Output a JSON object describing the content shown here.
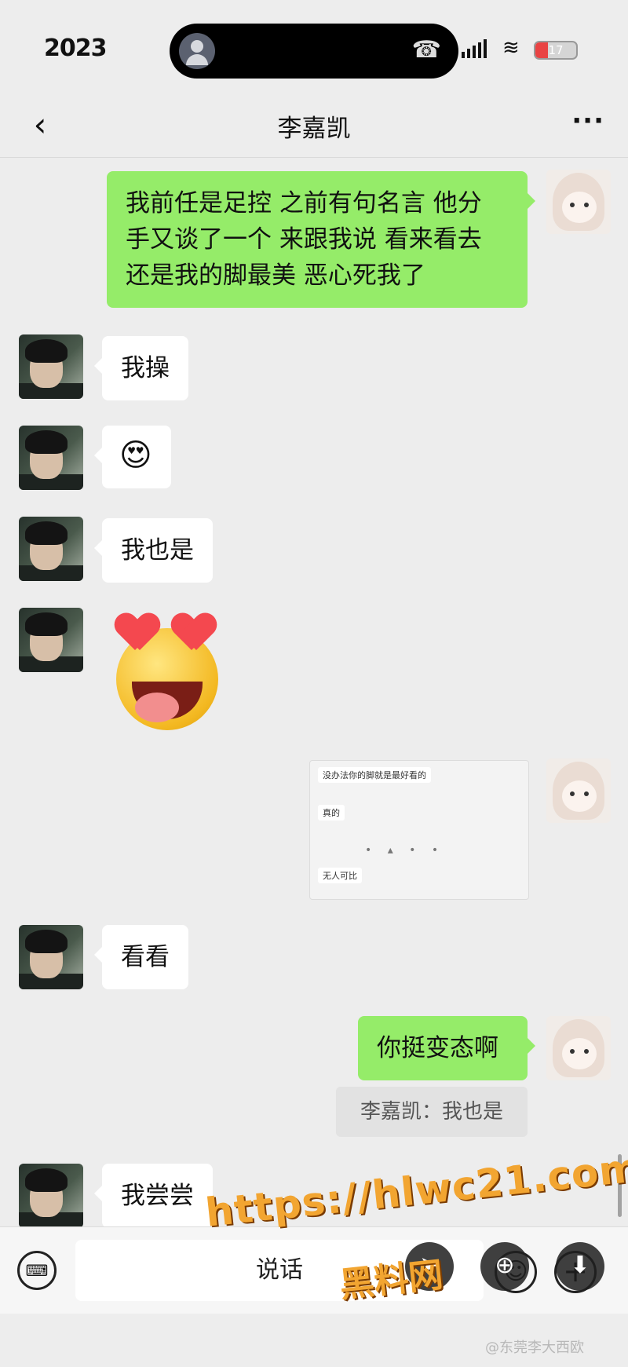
{
  "status_bar": {
    "time": "2023",
    "battery": "17",
    "call_icon": "phone-hangup-icon"
  },
  "nav": {
    "title": "李嘉凯",
    "back_icon": "back-icon",
    "more_label": "···"
  },
  "messages": [
    {
      "side": "out",
      "type": "text",
      "text_lines": [
        "我前任是足控 之前有句名言 他分",
        "手又谈了一个 来跟我说 看来看去",
        "还是我的脚最美 恶心死我了"
      ]
    },
    {
      "side": "in",
      "type": "text",
      "text": "我操"
    },
    {
      "side": "in",
      "type": "emoji",
      "emoji": "😍"
    },
    {
      "side": "in",
      "type": "text",
      "text": "我也是"
    },
    {
      "side": "in",
      "type": "sticker",
      "sticker": "heart-eyes-drooling-sticker"
    },
    {
      "side": "out",
      "type": "image",
      "lines": [
        "没办法你的脚就是最好看的",
        "真的",
        "无人可比"
      ]
    },
    {
      "side": "in",
      "type": "text",
      "text": "看看"
    },
    {
      "side": "out",
      "type": "text",
      "text": "你挺变态啊"
    },
    {
      "side": "quote",
      "type": "quote",
      "text": "李嘉凯：我也是"
    },
    {
      "side": "in",
      "type": "text",
      "text": "我尝尝"
    }
  ],
  "input_bar": {
    "hold_to_talk": "说话",
    "keyboard_icon": "keyboard-icon",
    "emoji_icon": "emoji-icon",
    "plus_icon": "plus-icon"
  },
  "watermark": {
    "url": "https://hlwc21.com",
    "site": "黑料网",
    "weibo": "@东莞李大西欧"
  }
}
